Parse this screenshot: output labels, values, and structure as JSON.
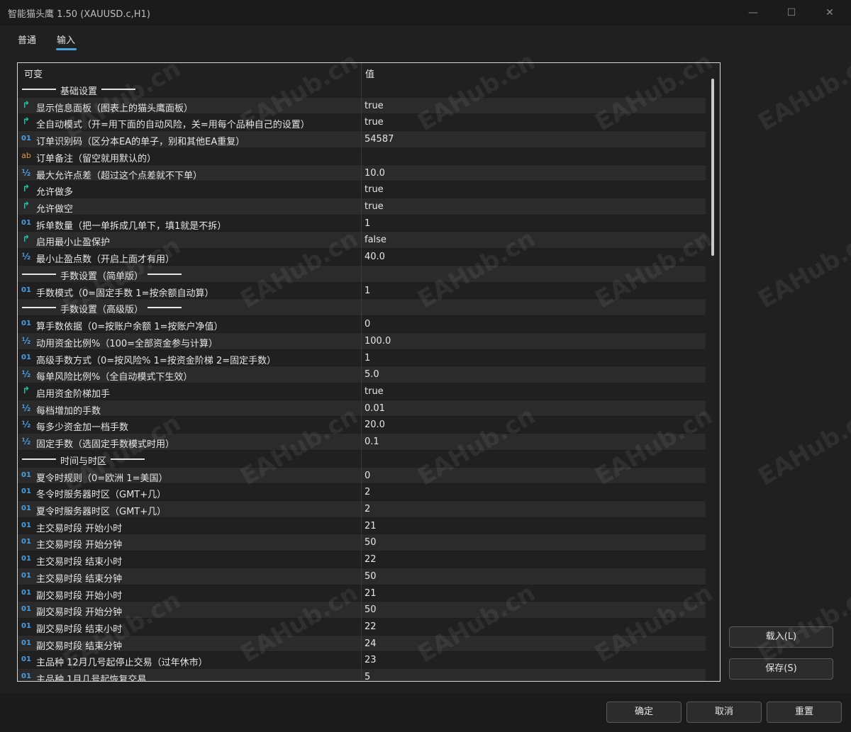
{
  "window": {
    "title": "智能猫头鹰 1.50 (XAUUSD.c,H1)",
    "min_glyph": "—",
    "max_glyph": "☐",
    "close_glyph": "✕"
  },
  "tabs": [
    {
      "label": "普通",
      "active": false
    },
    {
      "label": "输入",
      "active": true
    }
  ],
  "grid": {
    "col_name": "可变",
    "col_value": "值",
    "rows": [
      {
        "kind": "sep",
        "label": "基础设置",
        "value": ""
      },
      {
        "kind": "bool",
        "label": "显示信息面板（图表上的猫头鹰面板）",
        "value": "true"
      },
      {
        "kind": "bool",
        "label": "全自动模式（开=用下面的自动风险，关=用每个品种自己的设置）",
        "value": "true"
      },
      {
        "kind": "int",
        "label": "订单识别码（区分本EA的单子，别和其他EA重复）",
        "value": "54587"
      },
      {
        "kind": "str",
        "label": "订单备注（留空就用默认的）",
        "value": ""
      },
      {
        "kind": "dbl",
        "label": "最大允许点差（超过这个点差就不下单）",
        "value": "10.0"
      },
      {
        "kind": "bool",
        "label": "允许做多",
        "value": "true"
      },
      {
        "kind": "bool",
        "label": "允许做空",
        "value": "true"
      },
      {
        "kind": "int",
        "label": "拆单数量（把一单拆成几单下，填1就是不拆）",
        "value": "1"
      },
      {
        "kind": "bool",
        "label": "启用最小止盈保护",
        "value": "false"
      },
      {
        "kind": "dbl",
        "label": "最小止盈点数（开启上面才有用）",
        "value": "40.0"
      },
      {
        "kind": "sep",
        "label": "手数设置（简单版）",
        "value": ""
      },
      {
        "kind": "int",
        "label": "手数模式（0=固定手数 1=按余额自动算）",
        "value": "1"
      },
      {
        "kind": "sep",
        "label": "手数设置（高级版）",
        "value": ""
      },
      {
        "kind": "int",
        "label": "算手数依据（0=按账户余额 1=按账户净值）",
        "value": "0"
      },
      {
        "kind": "dbl",
        "label": "动用资金比例%（100=全部资金参与计算）",
        "value": "100.0"
      },
      {
        "kind": "int",
        "label": "高级手数方式（0=按风险% 1=按资金阶梯 2=固定手数）",
        "value": "1"
      },
      {
        "kind": "dbl",
        "label": "每单风险比例%（全自动模式下生效）",
        "value": "5.0"
      },
      {
        "kind": "bool",
        "label": "启用资金阶梯加手",
        "value": "true"
      },
      {
        "kind": "dbl",
        "label": "每档增加的手数",
        "value": "0.01"
      },
      {
        "kind": "dbl",
        "label": "每多少资金加一档手数",
        "value": "20.0"
      },
      {
        "kind": "dbl",
        "label": "固定手数（选固定手数模式时用）",
        "value": "0.1"
      },
      {
        "kind": "sep",
        "label": "时间与时区",
        "value": ""
      },
      {
        "kind": "int",
        "label": "夏令时规则（0=欧洲 1=美国）",
        "value": "0"
      },
      {
        "kind": "int",
        "label": "冬令时服务器时区（GMT+几）",
        "value": "2"
      },
      {
        "kind": "int",
        "label": "夏令时服务器时区（GMT+几）",
        "value": "2"
      },
      {
        "kind": "int",
        "label": "主交易时段 开始小时",
        "value": "21"
      },
      {
        "kind": "int",
        "label": "主交易时段 开始分钟",
        "value": "50"
      },
      {
        "kind": "int",
        "label": "主交易时段 结束小时",
        "value": "22"
      },
      {
        "kind": "int",
        "label": "主交易时段 结束分钟",
        "value": "50"
      },
      {
        "kind": "int",
        "label": "副交易时段 开始小时",
        "value": "21"
      },
      {
        "kind": "int",
        "label": "副交易时段 开始分钟",
        "value": "50"
      },
      {
        "kind": "int",
        "label": "副交易时段 结束小时",
        "value": "22"
      },
      {
        "kind": "int",
        "label": "副交易时段 结束分钟",
        "value": "24"
      },
      {
        "kind": "int",
        "label": "主品种 12月几号起停止交易（过年休市）",
        "value": "23"
      },
      {
        "kind": "int",
        "label": "主品种 1月几号起恢复交易",
        "value": "5"
      }
    ]
  },
  "icons": {
    "bool": {
      "name": "bool-param-icon",
      "glyph": "↱"
    },
    "int": {
      "name": "int-param-icon",
      "glyph": "01"
    },
    "dbl": {
      "name": "double-param-icon",
      "glyph": "½"
    },
    "str": {
      "name": "string-param-icon",
      "glyph": "ab"
    }
  },
  "buttons": {
    "load": "载入(L)",
    "save": "保存(S)",
    "ok": "确定",
    "cancel": "取消",
    "reset": "重置"
  },
  "watermark": "EAHub.cn",
  "colors": {
    "accent": "#4aa3e0",
    "bool_icon": "#20c0a0",
    "int_icon": "#4a9fe6",
    "str_icon": "#e0953c",
    "row_alt": "#2b2b2b",
    "background": "#202020"
  }
}
